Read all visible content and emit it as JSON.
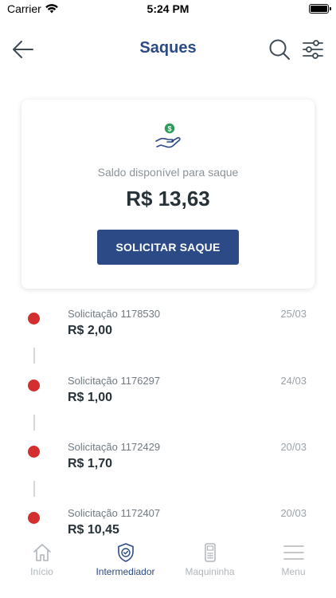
{
  "status_bar": {
    "carrier": "Carrier",
    "time": "5:24 PM",
    "wifi_icon": "wifi-icon",
    "battery_icon": "battery-icon"
  },
  "header": {
    "title": "Saques",
    "back_icon": "arrow-left-icon",
    "search_icon": "search-icon",
    "filter_icon": "sliders-icon"
  },
  "balance_card": {
    "icon": "hand-dollar-coin-icon",
    "label": "Saldo disponível para saque",
    "value": "R$ 13,63",
    "button_label": "SOLICITAR SAQUE"
  },
  "requests": [
    {
      "title": "Solicitação 1178530",
      "amount": "R$ 2,00",
      "date": "25/03",
      "status_color": "#d32f2f"
    },
    {
      "title": "Solicitação 1176297",
      "amount": "R$ 1,00",
      "date": "24/03",
      "status_color": "#d32f2f"
    },
    {
      "title": "Solicitação 1172429",
      "amount": "R$ 1,70",
      "date": "20/03",
      "status_color": "#d32f2f"
    },
    {
      "title": "Solicitação 1172407",
      "amount": "R$ 10,45",
      "date": "20/03",
      "status_color": "#d32f2f"
    }
  ],
  "tab_bar": {
    "tabs": [
      {
        "label": "Início",
        "icon": "home-icon",
        "active": false
      },
      {
        "label": "Intermediador",
        "icon": "shield-check-icon",
        "active": true
      },
      {
        "label": "Maquininha",
        "icon": "card-machine-icon",
        "active": false
      },
      {
        "label": "Menu",
        "icon": "hamburger-menu-icon",
        "active": false
      }
    ]
  },
  "colors": {
    "primary": "#2c4a85",
    "accent_green": "#2e9b5b",
    "status_red": "#d32f2f",
    "inactive": "#b0b6bb"
  }
}
